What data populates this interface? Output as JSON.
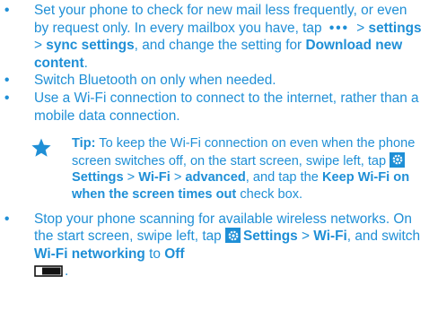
{
  "bullets": {
    "item1": {
      "text1": "Set your phone to check for new mail less frequently, or even by request only. In every mailbox you have, tap",
      "more_icon": "•••",
      "sep1": ">",
      "bold1": "settings",
      "sep2": ">",
      "bold2": "sync settings",
      "text2": ", and change the setting for",
      "bold3": "Download new content",
      "end": "."
    },
    "item2": {
      "text": "Switch Bluetooth on only when needed."
    },
    "item3": {
      "text": "Use a Wi-Fi connection to connect to the internet, rather than a mobile data connection."
    },
    "item4": {
      "text1": "Stop your phone scanning for available wireless networks. On the start screen, swipe left, tap",
      "bold1": "Settings",
      "sep1": ">",
      "bold2": "Wi-Fi",
      "text2": ", and switch",
      "bold3": "Wi-Fi networking",
      "text3": "to",
      "bold4": "Off",
      "end": "."
    }
  },
  "tip": {
    "label": "Tip:",
    "text1": "To keep the Wi-Fi connection on even when the phone screen switches off, on the start screen, swipe left, tap",
    "bold1": "Settings",
    "sep1": ">",
    "bold2": "Wi-Fi",
    "sep2": ">",
    "bold3": "advanced",
    "text2": ", and tap the",
    "bold4": "Keep Wi-Fi on when the screen times out",
    "text3": "check box."
  },
  "bullet_symbol": "•",
  "colors": {
    "text": "#1f8fd6",
    "icon": "#1f8fd6",
    "background": "#ffffff"
  },
  "icons": [
    "more-icon",
    "star-icon",
    "settings-gear-icon",
    "switch-off-icon"
  ]
}
